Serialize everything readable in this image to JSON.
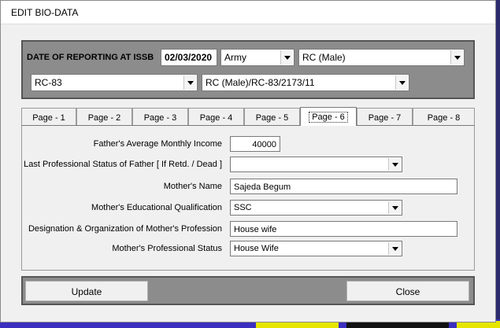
{
  "window": {
    "title": "EDIT BIO-DATA"
  },
  "header": {
    "reporting_label": "DATE OF REPORTING AT ISSB",
    "reporting_date": "02/03/2020",
    "service": "Army",
    "center": "RC (Male)",
    "rc_code": "RC-83",
    "reference": "RC (Male)/RC-83/2173/11"
  },
  "tabs": [
    {
      "label": "Page - 1"
    },
    {
      "label": "Page - 2"
    },
    {
      "label": "Page - 3"
    },
    {
      "label": "Page - 4"
    },
    {
      "label": "Page - 5"
    },
    {
      "label": "Page - 6"
    },
    {
      "label": "Page - 7"
    },
    {
      "label": "Page - 8"
    }
  ],
  "active_tab": "Page - 6",
  "form": {
    "father_income_label": "Father's Average Monthly Income",
    "father_income_value": "40000",
    "father_status_label": "Last Professional Status of Father [ If Retd. / Dead ]",
    "father_status_value": "",
    "mother_name_label": "Mother's Name",
    "mother_name_value": "Sajeda Begum",
    "mother_edu_label": "Mother's Educational Qualification",
    "mother_edu_value": "SSC",
    "mother_designation_label": "Designation & Organization of Mother's Profession",
    "mother_designation_value": "House wife",
    "mother_status_label": "Mother's Professional Status",
    "mother_status_value": "House Wife"
  },
  "footer": {
    "update_label": "Update",
    "close_label": "Close"
  }
}
